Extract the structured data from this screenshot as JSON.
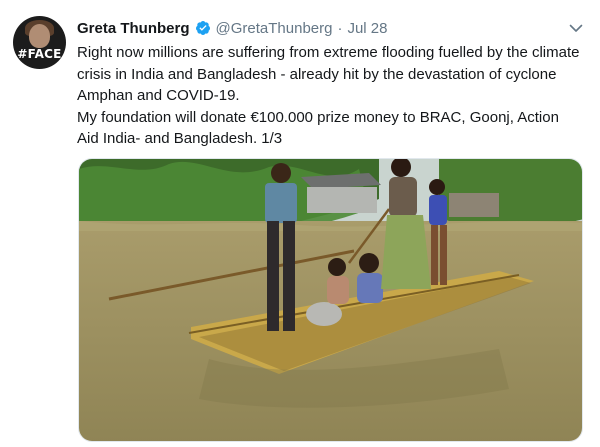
{
  "author": {
    "name": "Greta Thunberg",
    "handle": "@GretaThunberg",
    "separator": "·",
    "date": "Jul 28",
    "avatar_tag": "#FACE",
    "verified_icon": "verified-badge-icon"
  },
  "tweet": {
    "lines": [
      "Right now millions are suffering from extreme flooding fuelled by the climate crisis in India and Bangladesh - already hit by the devastation of cyclone Amphan and COVID-19.",
      "My foundation will donate €100.000 prize money to BRAC, Goonj, Action Aid India- and Bangladesh. 1/3"
    ]
  },
  "icons": {
    "menu": "chevron-down-icon"
  },
  "colors": {
    "name": "#14171a",
    "secondary": "#657786",
    "verified": "#1da1f2",
    "flood_water": "#9c8f5e",
    "foliage": "#3f7a2e"
  }
}
